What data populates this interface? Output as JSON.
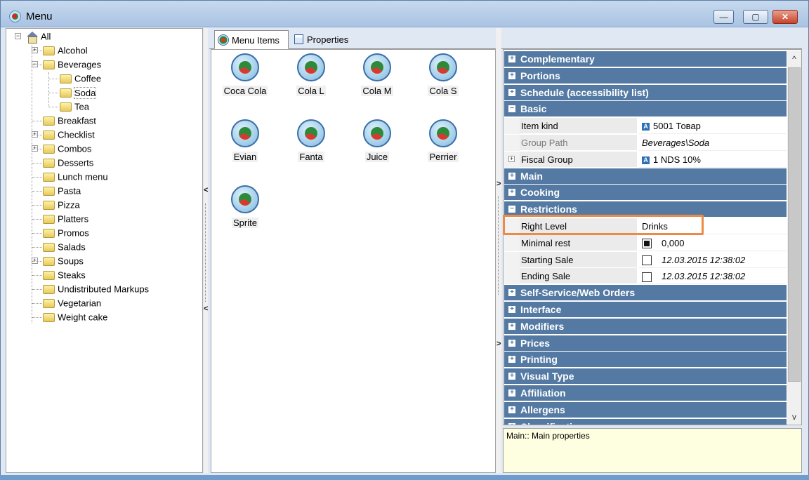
{
  "window": {
    "title": "Menu",
    "buttons": {
      "minimize": "—",
      "maximize": "▢",
      "close": "✕"
    }
  },
  "tree": {
    "root": "All",
    "items": [
      {
        "label": "Alcohol",
        "expander": "+"
      },
      {
        "label": "Beverages",
        "expander": "−"
      },
      {
        "label": "Coffee"
      },
      {
        "label": "Soda"
      },
      {
        "label": "Tea"
      },
      {
        "label": "Breakfast"
      },
      {
        "label": "Checklist",
        "expander": "+"
      },
      {
        "label": "Combos",
        "expander": "+"
      },
      {
        "label": "Desserts"
      },
      {
        "label": "Lunch menu"
      },
      {
        "label": "Pasta"
      },
      {
        "label": "Pizza"
      },
      {
        "label": "Platters"
      },
      {
        "label": "Promos"
      },
      {
        "label": "Salads"
      },
      {
        "label": "Soups",
        "expander": "+"
      },
      {
        "label": "Steaks"
      },
      {
        "label": "Undistributed Markups"
      },
      {
        "label": "Vegetarian"
      },
      {
        "label": "Weight cake"
      }
    ]
  },
  "splitters": {
    "left_arrow": "<",
    "right_arrow": ">"
  },
  "tabs": [
    {
      "label": "Menu Items",
      "icon": "menu-items-icon"
    },
    {
      "label": "Properties",
      "icon": "properties-icon"
    }
  ],
  "menu_items": [
    "Coca Cola",
    "Cola L",
    "Cola M",
    "Cola S",
    "Evian",
    "Fanta",
    "Juice",
    "Perrier",
    "Sprite"
  ],
  "properties": {
    "categories_top": [
      "Complementary",
      "Portions",
      "Schedule (accessibility list)"
    ],
    "basic": {
      "label": "Basic",
      "rows": [
        {
          "name": "Item kind",
          "value": "5001 Товар",
          "badge": "A"
        },
        {
          "name": "Group Path",
          "value": "Beverages\\Soda"
        },
        {
          "name": "Fiscal Group",
          "value": "1 NDS 10%",
          "badge": "A",
          "expander": "+"
        }
      ]
    },
    "categories_mid": [
      "Main",
      "Cooking"
    ],
    "restrictions": {
      "label": "Restrictions",
      "rows": [
        {
          "name": "Right Level",
          "value": "Drinks"
        },
        {
          "name": "Minimal rest",
          "value": "0,000",
          "checked": true
        },
        {
          "name": "Starting Sale",
          "value": "12.03.2015 12:38:02",
          "checked": false
        },
        {
          "name": "Ending Sale",
          "value": "12.03.2015 12:38:02",
          "checked": false
        }
      ]
    },
    "categories_bottom": [
      "Self-Service/Web Orders",
      "Interface",
      "Modifiers",
      "Prices",
      "Printing",
      "Visual Type",
      "Affiliation",
      "Allergens",
      "Classification"
    ],
    "expand_glyph": "+",
    "collapse_glyph": "−"
  },
  "scroll": {
    "up": "^",
    "down": "v"
  },
  "description": "Main:: Main properties",
  "colors": {
    "category_bg": "#547aa3",
    "highlight_border": "#ec8a46",
    "description_bg": "#fefee1"
  }
}
